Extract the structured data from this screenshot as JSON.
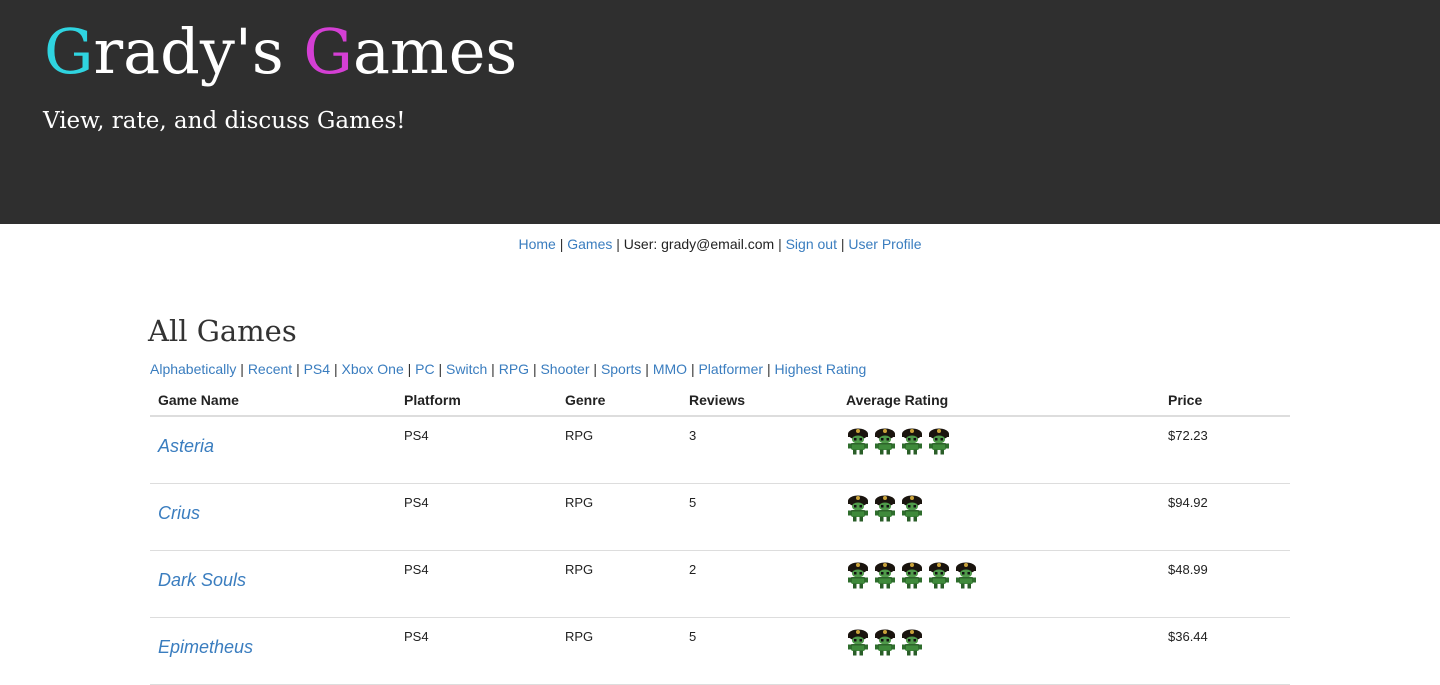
{
  "header": {
    "title_g1": "G",
    "title_part1": "rady's ",
    "title_g2": "G",
    "title_part2": "ames",
    "tagline": "View, rate, and discuss Games!",
    "colors": {
      "background": "#2f2f2f",
      "accent1": "#2fd4e0",
      "accent2": "#d43fd4"
    }
  },
  "nav": {
    "home": "Home",
    "games": "Games",
    "user_text": "User: grady@email.com",
    "sign_out": "Sign out",
    "profile": "User Profile",
    "separator": "|"
  },
  "page": {
    "heading": "All Games",
    "filters": [
      "Alphabetically",
      "Recent",
      "PS4",
      "Xbox One",
      "PC",
      "Switch",
      "RPG",
      "Shooter",
      "Sports",
      "MMO",
      "Platformer",
      "Highest Rating"
    ]
  },
  "table": {
    "headers": {
      "name": "Game Name",
      "platform": "Platform",
      "genre": "Genre",
      "reviews": "Reviews",
      "rating": "Average Rating",
      "price": "Price"
    },
    "rows": [
      {
        "name": "Asteria",
        "platform": "PS4",
        "genre": "RPG",
        "reviews": "3",
        "rating": 4,
        "price": "$72.23"
      },
      {
        "name": "Crius",
        "platform": "PS4",
        "genre": "RPG",
        "reviews": "5",
        "rating": 3,
        "price": "$94.92"
      },
      {
        "name": "Dark Souls",
        "platform": "PS4",
        "genre": "RPG",
        "reviews": "2",
        "rating": 5,
        "price": "$48.99"
      },
      {
        "name": "Epimetheus",
        "platform": "PS4",
        "genre": "RPG",
        "reviews": "5",
        "rating": 3,
        "price": "$36.44"
      }
    ],
    "rating_icon": "goblin-character-icon"
  }
}
